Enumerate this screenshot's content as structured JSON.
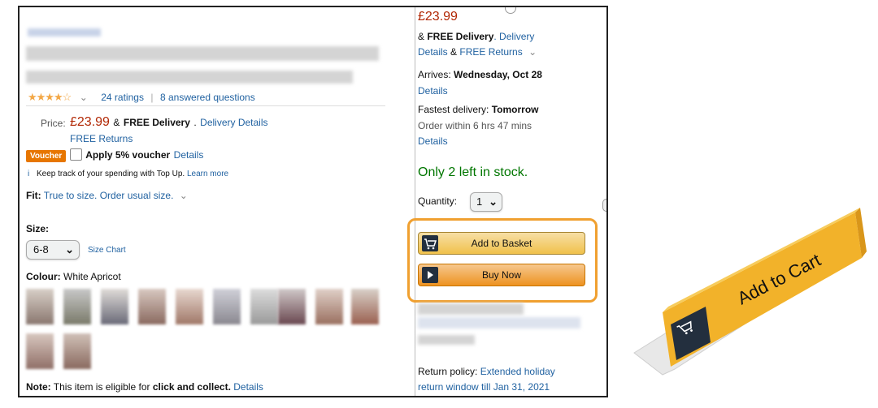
{
  "left": {
    "rating_count": "24 ratings",
    "separator": "|",
    "answered": "8 answered questions",
    "price_label": "Price:",
    "price": "£23.99",
    "price_delivery_sep": "&",
    "free_delivery": "FREE Delivery",
    "dot": ".",
    "delivery_details": "Delivery Details",
    "free_returns": "FREE Returns",
    "voucher_badge": "Voucher",
    "apply_voucher": "Apply 5% voucher",
    "voucher_details": "Details",
    "info_icon": "i",
    "topup_text": "Keep track of your spending with Top Up.",
    "learn_more": "Learn more",
    "fit_label": "Fit:",
    "fit_value": "True to size. Order usual size.",
    "size_label": "Size:",
    "size_value": "6-8",
    "size_chart": "Size Chart",
    "colour_label": "Colour:",
    "colour_value": "White Apricot",
    "note_label": "Note:",
    "note_text": "This item is eligible for",
    "note_bold": "click and collect.",
    "note_details": "Details",
    "chevron": "⌄"
  },
  "right": {
    "price": "£23.99",
    "free_delivery_prefix": "& ",
    "free_delivery": "FREE Delivery",
    "delivery_link": ". Delivery",
    "details_link": "Details",
    "amp": " & ",
    "free_returns": "FREE Returns",
    "arrives_label": "Arrives:",
    "arrives_date": "Wednesday, Oct 28",
    "arrives_details": "Details",
    "fastest_label": "Fastest delivery:",
    "fastest_value": "Tomorrow",
    "order_within": "Order within 6 hrs 47 mins",
    "fastest_details": "Details",
    "stock": "Only 2 left in stock.",
    "quantity_label": "Quantity:",
    "quantity_value": "1",
    "add_to_basket": "Add to Basket",
    "buy_now": "Buy Now",
    "return_policy_label": "Return policy:",
    "return_policy_link": "Extended holiday",
    "return_window": "return window till Jan 31, 2021"
  },
  "illustration": {
    "sign_text": "Add to Cart",
    "icon": "cart-icon"
  },
  "colors": {
    "link": "#2162a1",
    "price": "#b12704",
    "stock": "#007600",
    "basket_btn": "#f7d048",
    "buy_btn": "#f0a030",
    "highlight": "#f0a030",
    "sign": "#f2b22a"
  }
}
